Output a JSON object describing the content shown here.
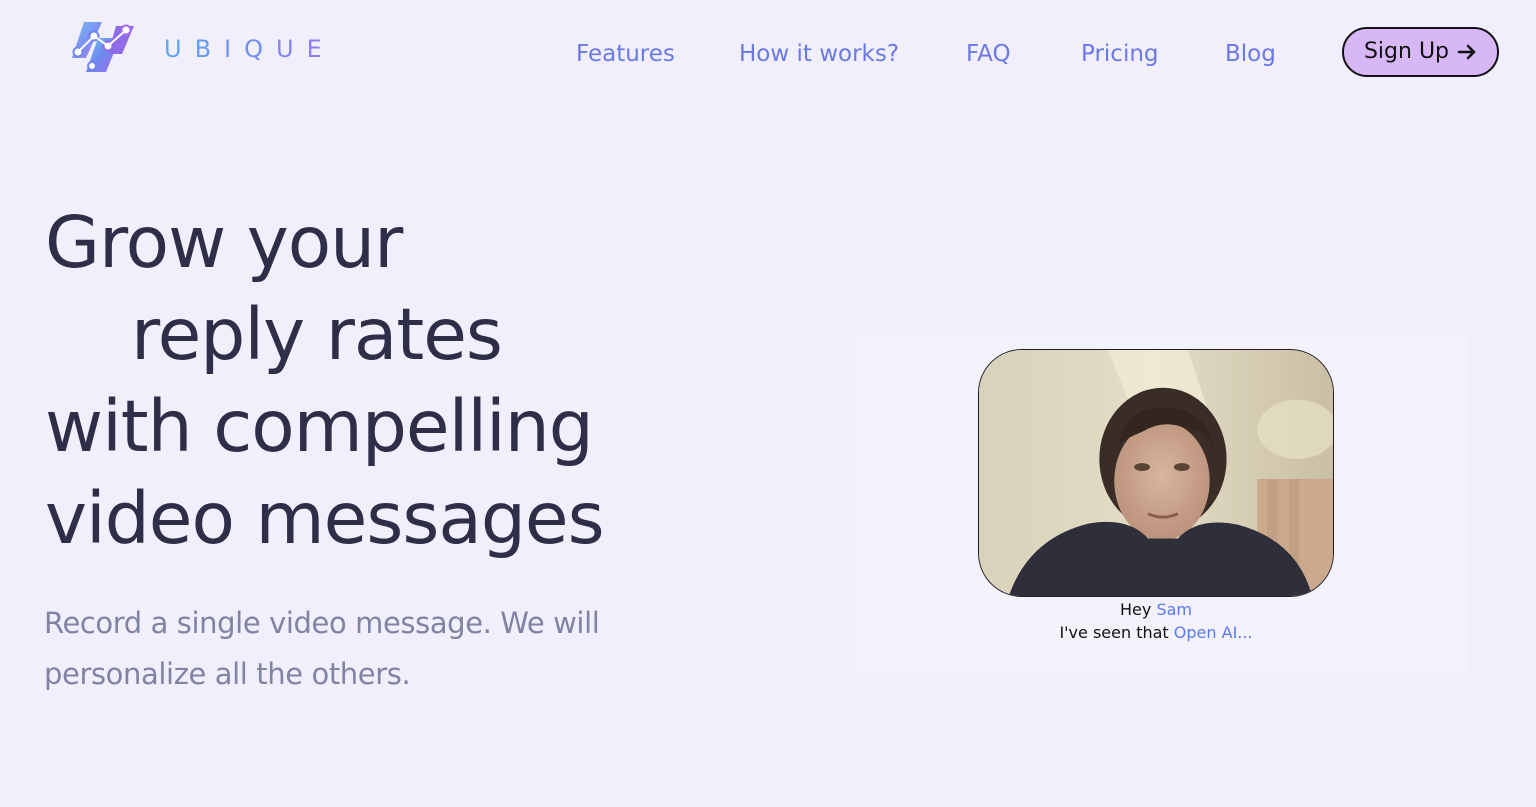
{
  "brand": {
    "name": "UBIQUE"
  },
  "nav": {
    "items": [
      {
        "label": "Features"
      },
      {
        "label": "How it works?"
      },
      {
        "label": "FAQ"
      },
      {
        "label": "Pricing"
      },
      {
        "label": "Blog"
      }
    ],
    "cta_label": "Sign Up"
  },
  "hero": {
    "title_lines": [
      "Grow your",
      "reply rates",
      "with compelling",
      "video messages"
    ],
    "subtitle": "Record a single video message. We will personalize all the others."
  },
  "video": {
    "caption": {
      "line1_prefix": "Hey",
      "line1_name": "Sam",
      "line2_prefix": "I've seen that",
      "line2_company": "Open AI..."
    }
  },
  "colors": {
    "background": "#f1effc",
    "nav_link": "#6a79e3",
    "cta_fill": "#d8b7f7",
    "heading": "#2f2e48",
    "subtitle": "#8183a4",
    "caption_highlight": "#5b79ee"
  }
}
